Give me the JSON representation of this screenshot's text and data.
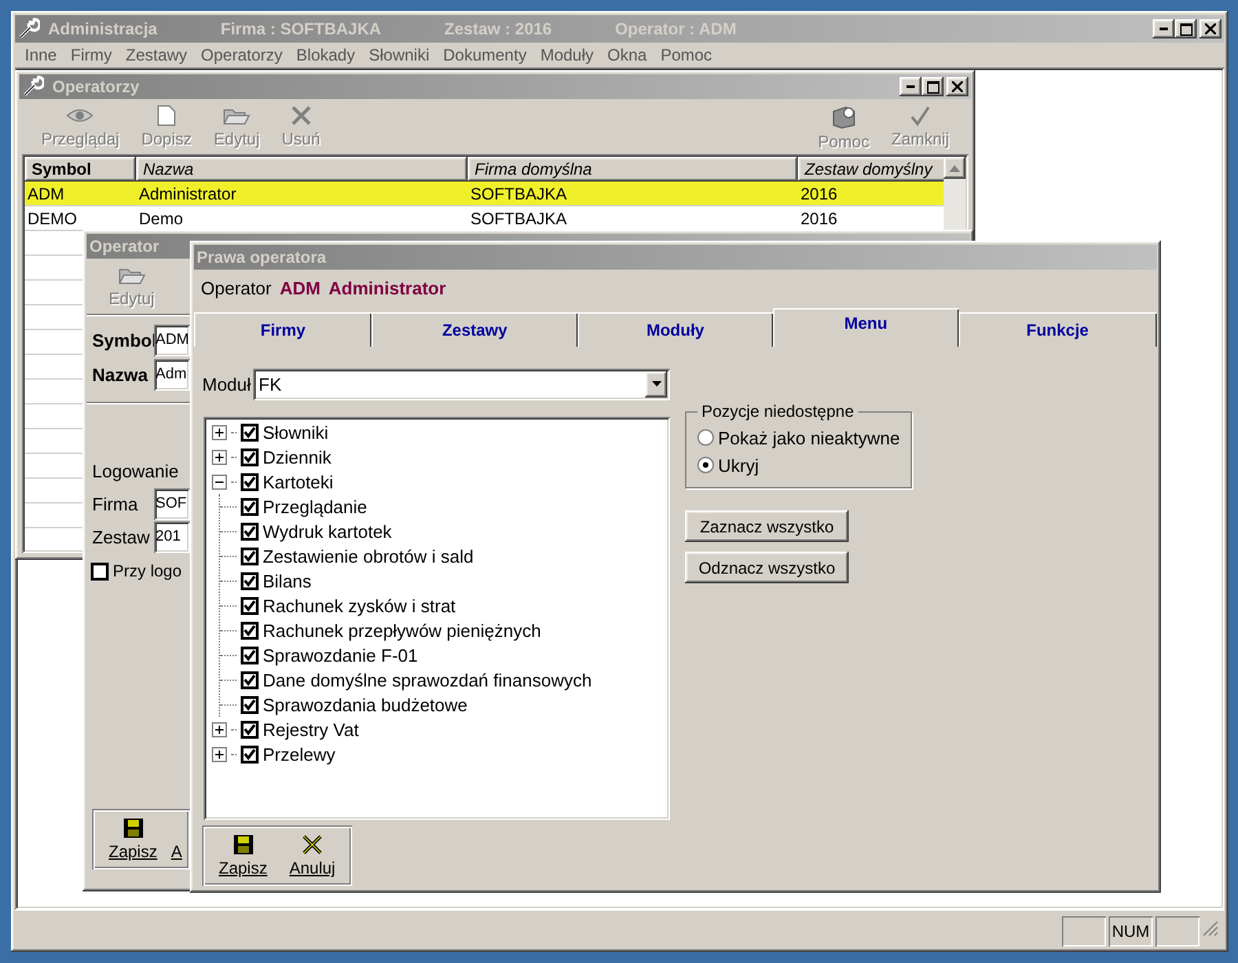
{
  "window": {
    "title": "Administracja",
    "company": "Firma : SOFTBAJKA",
    "set": "Zestaw : 2016",
    "operator": "Operator : ADM"
  },
  "menu": [
    "Inne",
    "Firmy",
    "Zestawy",
    "Operatorzy",
    "Blokady",
    "Słowniki",
    "Dokumenty",
    "Moduły",
    "Okna",
    "Pomoc"
  ],
  "operators_window": {
    "title": "Operatorzy",
    "toolbar_left": [
      {
        "label": "Przeglądaj",
        "kind": "view",
        "disabled": true
      },
      {
        "label": "Dopisz",
        "kind": "add",
        "disabled": true
      },
      {
        "label": "Edytuj",
        "kind": "edit",
        "disabled": true
      },
      {
        "label": "Usuń",
        "kind": "delete",
        "disabled": true
      }
    ],
    "toolbar_right": [
      {
        "label": "Pomoc",
        "kind": "help",
        "disabled": true
      },
      {
        "label": "Zamknij",
        "kind": "close",
        "disabled": true
      }
    ],
    "table": {
      "columns": [
        "Symbol",
        "Nazwa",
        "Firma domyślna",
        "Zestaw domyślny"
      ],
      "rows": [
        {
          "cells": [
            "ADM",
            "Administrator",
            "SOFTBAJKA",
            "2016"
          ],
          "selected": true
        },
        {
          "cells": [
            "DEMO",
            "Demo",
            "SOFTBAJKA",
            "2016"
          ],
          "selected": false
        }
      ]
    }
  },
  "operator_window": {
    "title": "Operator",
    "toolbar": [
      {
        "label": "Edytuj",
        "kind": "edit",
        "disabled": true
      }
    ],
    "fields": [
      {
        "label": "Symbol",
        "value": "ADM"
      },
      {
        "label": "Nazwa",
        "value": "Adm"
      }
    ],
    "login_heading": "Logowanie",
    "login_fields": [
      {
        "label": "Firma",
        "value": "SOF"
      },
      {
        "label": "Zestaw",
        "value": "201"
      }
    ],
    "checkbox": {
      "label": "Przy logo",
      "checked": false
    },
    "buttons": [
      {
        "label": "Zapisz",
        "kind": "save"
      },
      {
        "label": "A",
        "kind": "cut"
      }
    ]
  },
  "rights_window": {
    "title": "Prawa operatora",
    "operator_label": "Operator",
    "operator_symbol": "ADM",
    "operator_name": "Administrator",
    "tabs": [
      {
        "label": "Firmy",
        "selected": false
      },
      {
        "label": "Zestawy",
        "selected": false
      },
      {
        "label": "Moduły",
        "selected": false
      },
      {
        "label": "Menu",
        "selected": true
      },
      {
        "label": "Funkcje",
        "selected": false
      }
    ],
    "module_label": "Moduł",
    "module_value": "FK",
    "tree": [
      {
        "label": "Słowniki",
        "checked": true,
        "expanded": false
      },
      {
        "label": "Dziennik",
        "checked": true,
        "expanded": false
      },
      {
        "label": "Kartoteki",
        "checked": true,
        "expanded": true,
        "children": [
          {
            "label": "Przeglądanie",
            "checked": true
          },
          {
            "label": "Wydruk kartotek",
            "checked": true
          },
          {
            "label": "Zestawienie obrotów i sald",
            "checked": true
          },
          {
            "label": "Bilans",
            "checked": true
          },
          {
            "label": "Rachunek zysków i strat",
            "checked": true
          },
          {
            "label": "Rachunek przepływów pieniężnych",
            "checked": true
          },
          {
            "label": "Sprawozdanie F-01",
            "checked": true
          },
          {
            "label": "Dane domyślne sprawozdań finansowych",
            "checked": true
          },
          {
            "label": "Sprawozdania budżetowe",
            "checked": true
          }
        ]
      },
      {
        "label": "Rejestry Vat",
        "checked": true,
        "expanded": false
      },
      {
        "label": "Przelewy",
        "checked": true,
        "expanded": false
      }
    ],
    "group": {
      "title": "Pozycje niedostępne",
      "options": [
        {
          "label": "Pokaż jako nieaktywne",
          "selected": false
        },
        {
          "label": "Ukryj",
          "selected": true
        }
      ]
    },
    "actions": [
      "Zaznacz wszystko",
      "Odznacz wszystko"
    ],
    "buttons": [
      {
        "label": "Zapisz",
        "kind": "save"
      },
      {
        "label": "Anuluj",
        "kind": "cancel"
      }
    ]
  },
  "status_bar": [
    {
      "kind": "blank"
    },
    {
      "kind": "text",
      "text": "NUM"
    },
    {
      "kind": "blank"
    }
  ]
}
